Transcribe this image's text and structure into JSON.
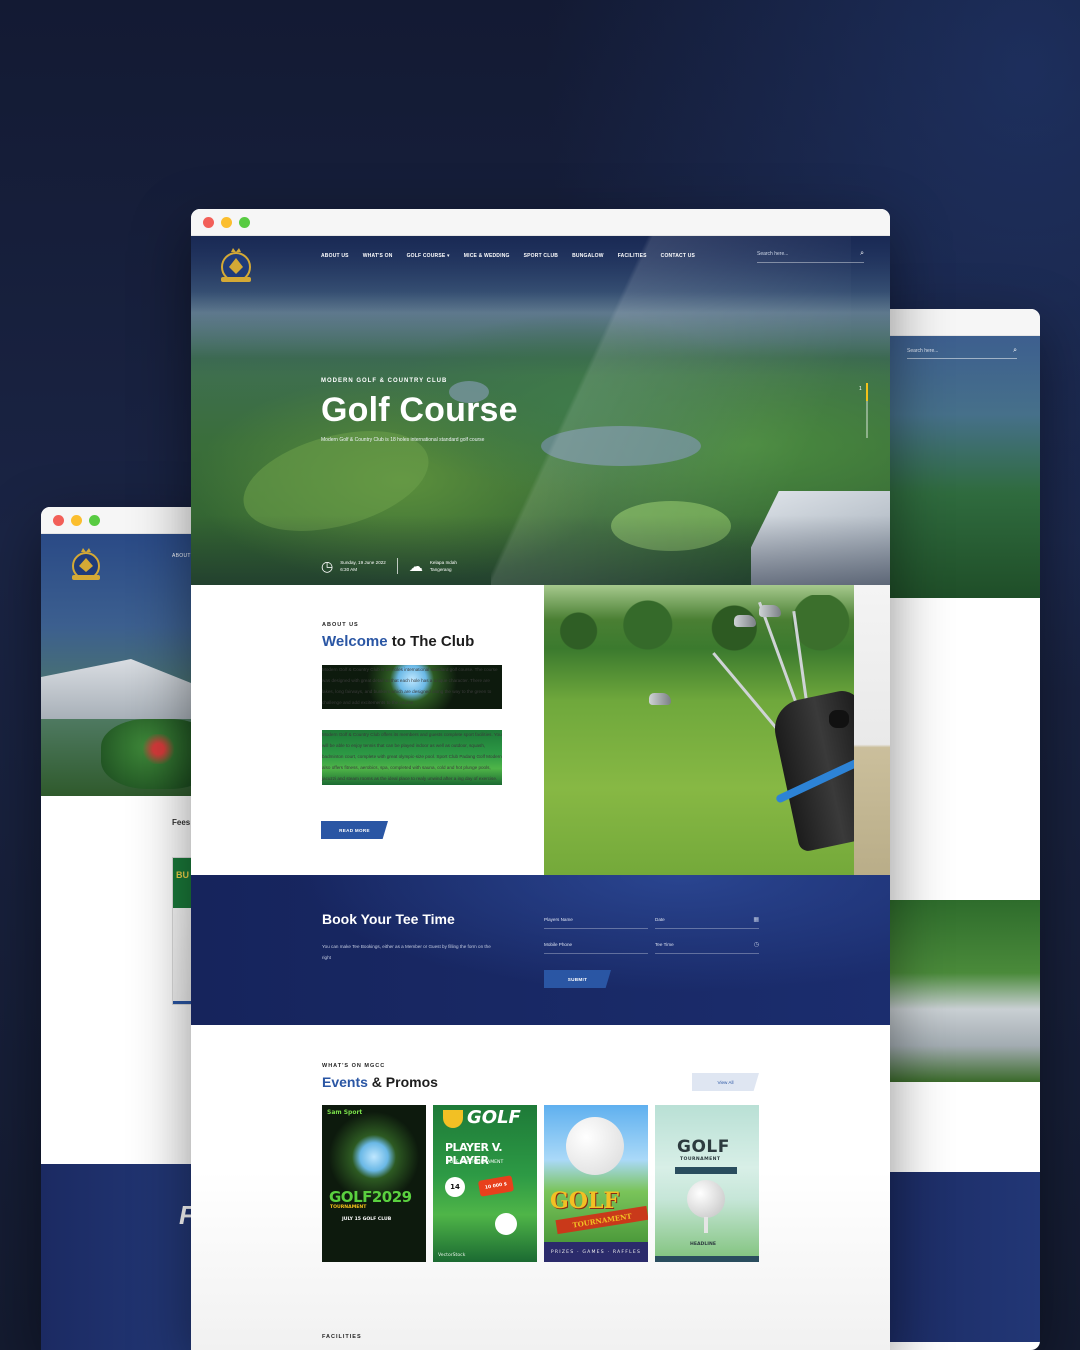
{
  "main": {
    "nav": {
      "menu": [
        "ABOUT US",
        "WHAT'S ON",
        "GOLF COURSE ▾",
        "MICE & WEDDING",
        "SPORT CLUB",
        "BUNGALOW",
        "FACILITIES",
        "CONTACT US"
      ],
      "search_placeholder": "Search here..."
    },
    "hero": {
      "kicker": "MODERN GOLF & COUNTRY CLUB",
      "title": "Golf Course",
      "subtitle": "Modern Golf & Country Club is 18 holes international standard golf course",
      "slide_number": "1",
      "date_line1": "Sunday, 19 June 2022",
      "date_line2": "6:30 AM",
      "location_line1": "Kelapa Indah",
      "location_line2": "Tangerang"
    },
    "about": {
      "kicker": "ABOUT US",
      "title_highlight": "Welcome",
      "title_rest": " to The Club",
      "paragraph1": "Modern Golf & Country Club is 18 holes international standard golf course. The course was designed with great detail so that each hole has a unique character. There are lakes, long fairways, and bunkers which are designed along the way to the green to challenge and add excitements to the course.",
      "paragraph2": "Modern Golf & Country Club offers its members and guests complete sport facilities. You will be able to enjoy tennis that can be played indoor as well as outdoor, squash, badminton court, complete with great olympic-size pool. Sport Club Padang Golf Modern also offers fitness, aerobics, spa, completed with sauna, cold and hot plunge pools, jacuzzi and steam rooms as the ideal place to realy unwind after a ing day of exercise.",
      "read_more": "READ MORE"
    },
    "booking": {
      "title": "Book  Your Tee Time",
      "description": "You can make Tee Bookings, either as a Member or Guest by filling the form on the right",
      "players_name": "Players Name",
      "date": "Date",
      "mobile_phone": "Mobile Phone",
      "tee_time": "Tee Time",
      "submit": "SUBMIT"
    },
    "events": {
      "kicker": "WHAT'S ON MGCC",
      "title_highlight": "Events",
      "title_rest": " & Promos",
      "view_all": "View All",
      "posters": [
        {
          "brand": "Sam Sport",
          "big": "GOLF2029",
          "small": "TOURNAMENT",
          "line": "JULY 15  GOLF CLUB"
        },
        {
          "golf": "GOLF",
          "pvp": "PLAYER V. PLAYER",
          "sub": "GOLF CUP TOURNAMENT",
          "badge": "14",
          "prize": "10 000 $",
          "credit": "VectorStock"
        },
        {
          "golf": "GOLF",
          "banner": "TOURNAMENT",
          "foot": "PRIZES · GAMES · RAFFLES"
        },
        {
          "golf": "GOLF",
          "sub": "TOURNAMENT",
          "headline": "HEADLINE"
        }
      ],
      "next_kicker": "FACILITIES"
    }
  },
  "left_window": {
    "menu_label": "ABOUT",
    "section_label": "Fees",
    "flyer_text": "BU",
    "band_glyph": "F"
  },
  "right_window": {
    "search_placeholder": "Search here..."
  },
  "colors": {
    "accent": "#2a56a4",
    "navy": "#1b2d6e",
    "background": "#151c34"
  },
  "icons": {
    "search": "magnifier",
    "clock": "clock",
    "weather": "cloud",
    "calendar": "calendar",
    "time": "clock"
  }
}
